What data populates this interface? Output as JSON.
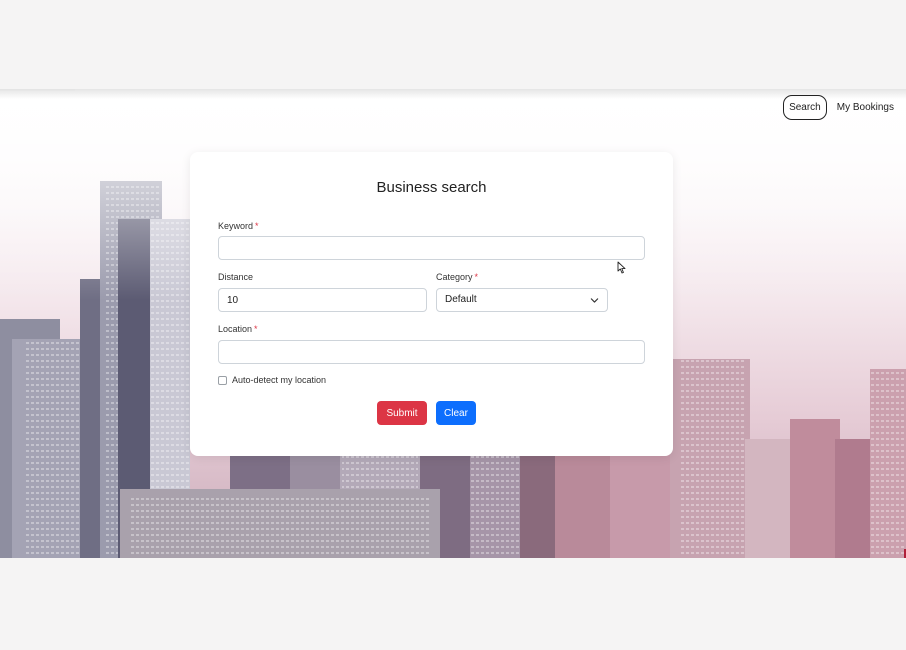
{
  "nav": {
    "search_label": "Search",
    "bookings_label": "My Bookings"
  },
  "form": {
    "title": "Business search",
    "keyword": {
      "label": "Keyword",
      "value": "",
      "required": "*"
    },
    "distance": {
      "label": "Distance",
      "value": "10"
    },
    "category": {
      "label": "Category",
      "selected": "Default",
      "required": "*"
    },
    "location": {
      "label": "Location",
      "value": "",
      "required": "*"
    },
    "autodetect": {
      "label": "Auto-detect my location",
      "checked": false
    },
    "submit_label": "Submit",
    "clear_label": "Clear"
  },
  "icons": {
    "select_arrow": "chevron-down-icon",
    "pointer": "mouse-cursor-icon"
  },
  "colors": {
    "submit": "#dc3545",
    "clear": "#0d6efd",
    "required": "#dc3545"
  }
}
